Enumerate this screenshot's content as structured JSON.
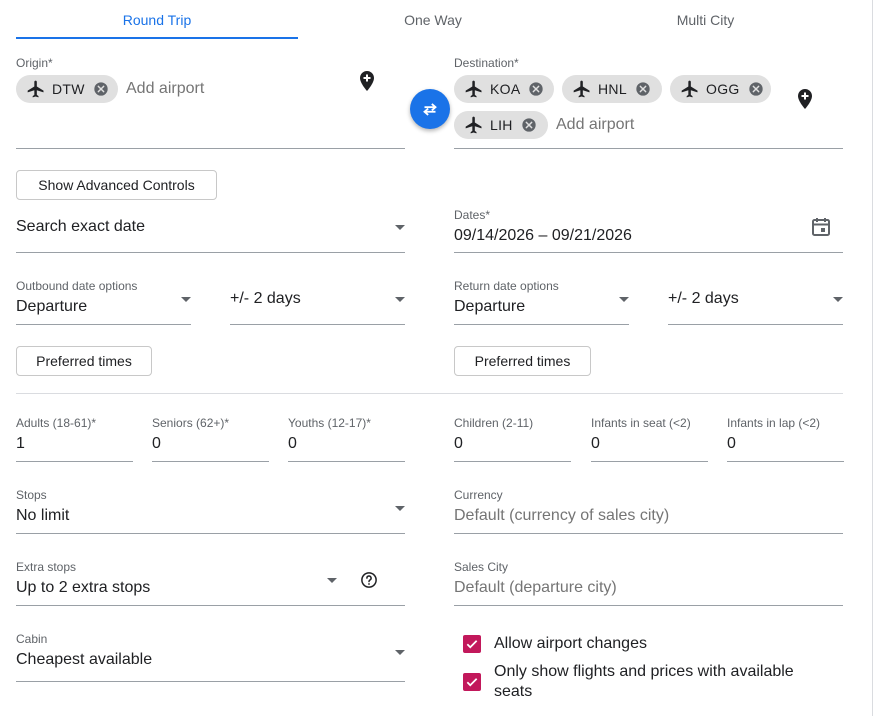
{
  "tabs": [
    {
      "label": "Round Trip",
      "active": true
    },
    {
      "label": "One Way",
      "active": false
    },
    {
      "label": "Multi City",
      "active": false
    }
  ],
  "origin": {
    "label": "Origin*",
    "chips": [
      "DTW"
    ],
    "placeholder": "Add airport"
  },
  "destination": {
    "label": "Destination*",
    "chips": [
      "KOA",
      "HNL",
      "OGG",
      "LIH"
    ],
    "placeholder": "Add airport"
  },
  "advanced_button": "Show Advanced Controls",
  "date_mode": {
    "value": "Search exact date"
  },
  "dates": {
    "label": "Dates*",
    "value": "09/14/2026 – 09/21/2026"
  },
  "outbound": {
    "label": "Outbound date options",
    "type_value": "Departure",
    "flex_value": "+/- 2 days",
    "preferred_times": "Preferred times"
  },
  "return": {
    "label": "Return date options",
    "type_value": "Departure",
    "flex_value": "+/- 2 days",
    "preferred_times": "Preferred times"
  },
  "passengers": [
    {
      "label": "Adults (18-61)*",
      "value": "1"
    },
    {
      "label": "Seniors (62+)*",
      "value": "0"
    },
    {
      "label": "Youths (12-17)*",
      "value": "0"
    },
    {
      "label": "Children (2-11)",
      "value": "0"
    },
    {
      "label": "Infants in seat (<2)",
      "value": "0"
    },
    {
      "label": "Infants in lap (<2)",
      "value": "0"
    }
  ],
  "stops": {
    "label": "Stops",
    "value": "No limit"
  },
  "currency": {
    "label": "Currency",
    "placeholder": "Default (currency of sales city)"
  },
  "extra_stops": {
    "label": "Extra stops",
    "value": "Up to 2 extra stops"
  },
  "sales_city": {
    "label": "Sales City",
    "placeholder": "Default (departure city)"
  },
  "cabin": {
    "label": "Cabin",
    "value": "Cheapest available"
  },
  "checkboxes": [
    {
      "label": "Allow airport changes",
      "checked": true
    },
    {
      "label": "Only show flights and prices with available seats",
      "checked": true
    }
  ],
  "icons": {
    "chip": "airplane-icon",
    "remove": "cancel-circle-icon",
    "add_location": "add-location-icon",
    "swap": "swap-horiz-icon",
    "calendar": "calendar-icon",
    "help": "help-circle-icon",
    "check": "check-icon"
  },
  "colors": {
    "accent": "#1a73e8",
    "checkbox": "#c2185b",
    "chip_bg": "#e0e0e0"
  }
}
